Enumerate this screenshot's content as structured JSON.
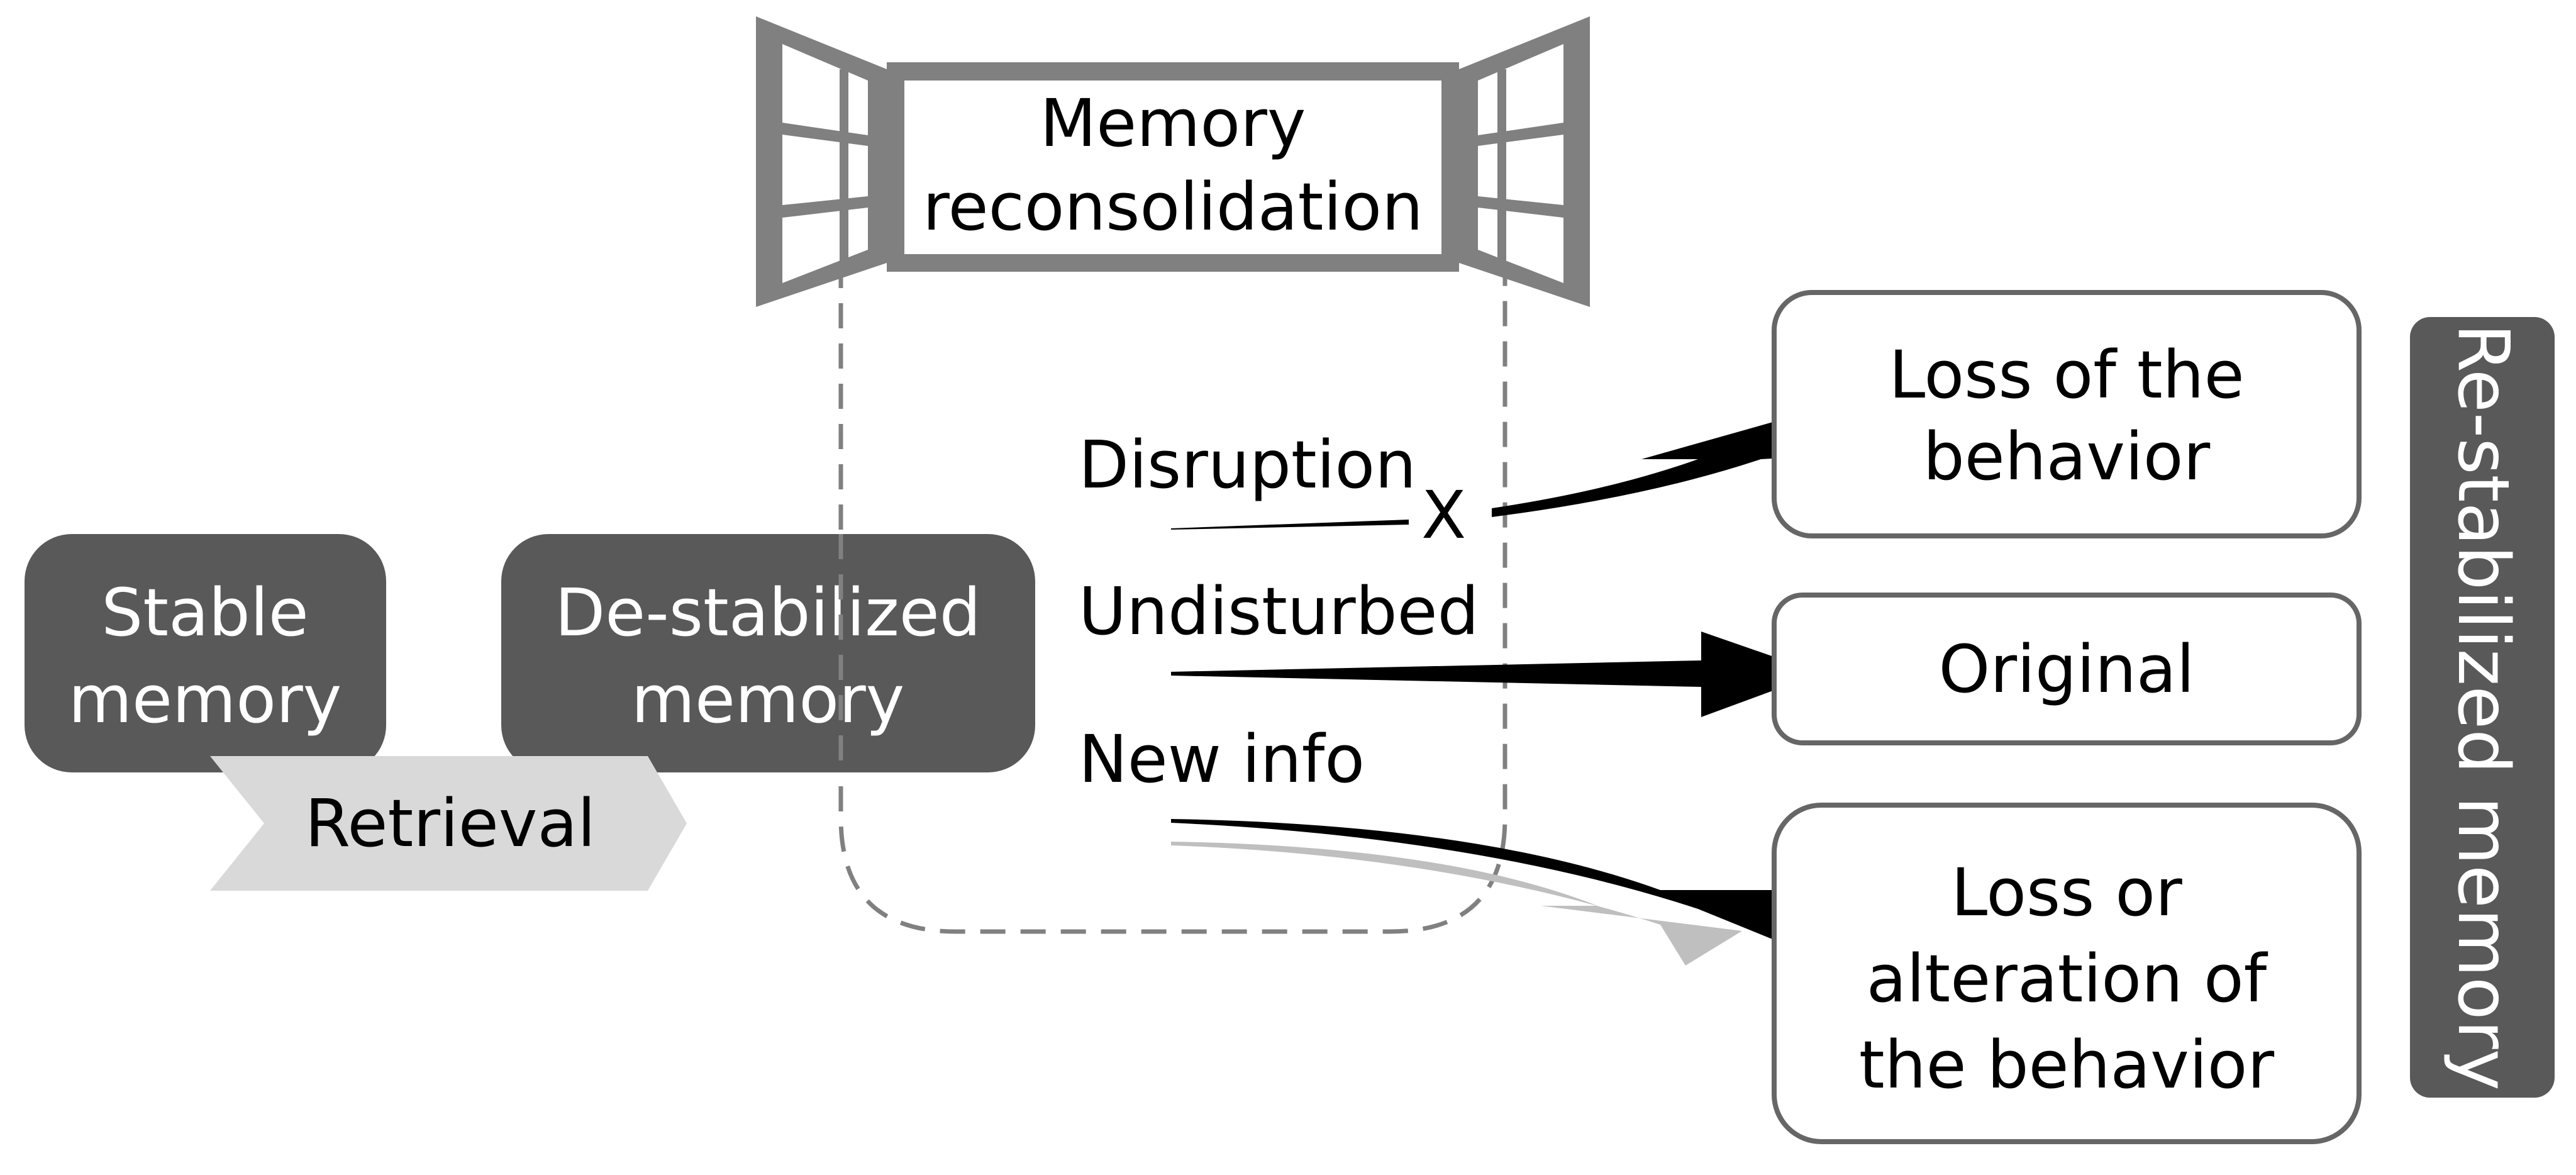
{
  "diagram": {
    "title": "Memory reconsolidation",
    "title_lines": [
      "Memory",
      "reconsolidation"
    ],
    "nodes": {
      "stable_memory": {
        "lines": [
          "Stable",
          "memory"
        ]
      },
      "destabilized_memory": {
        "lines": [
          "De-stabilized",
          "memory"
        ]
      },
      "retrieval": {
        "label": "Retrieval"
      },
      "outcome_loss": {
        "lines": [
          "Loss of the",
          "behavior"
        ]
      },
      "outcome_original": {
        "lines": [
          "Original"
        ]
      },
      "outcome_alteration": {
        "lines": [
          "Loss or",
          "alteration of",
          "the behavior"
        ]
      },
      "restabilized": {
        "label": "Re-stabilized memory"
      }
    },
    "conditions": {
      "disruption": "Disruption",
      "disruption_marker": "X",
      "undisturbed": "Undisturbed",
      "new_info": "New info"
    },
    "edges": [
      {
        "from": "stable_memory",
        "to": "destabilized_memory",
        "label": "Retrieval"
      },
      {
        "from": "disruption",
        "to": "outcome_loss"
      },
      {
        "from": "undisturbed",
        "to": "outcome_original"
      },
      {
        "from": "new_info",
        "to": "outcome_alteration"
      }
    ],
    "colors": {
      "dark_box": "#595959",
      "retrieval_chevron": "#d9d9d9",
      "window_frame": "#808080",
      "outline_box": "#666666",
      "arrow": "#000000",
      "arrow_ghost": "#bfbfbf",
      "dashed": "#808080"
    }
  }
}
